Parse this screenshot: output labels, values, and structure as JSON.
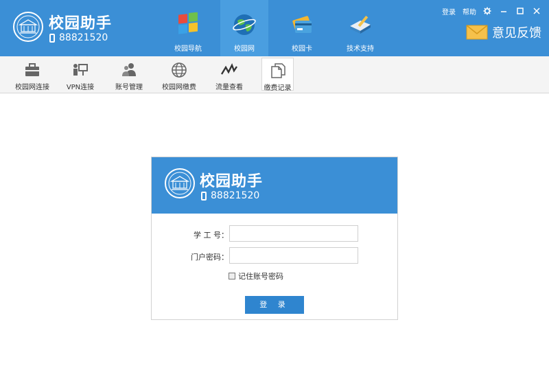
{
  "header": {
    "app_title": "校园助手",
    "phone": "88821520",
    "nav": [
      {
        "label": "校园导航",
        "icon": "windows-globe-icon"
      },
      {
        "label": "校园网",
        "icon": "globe-icon"
      },
      {
        "label": "校园卡",
        "icon": "card-icon"
      },
      {
        "label": "技术支持",
        "icon": "book-pencil-icon"
      }
    ],
    "active_nav": "校园网",
    "links": {
      "login": "登录",
      "help": "帮助"
    },
    "feedback": "意见反馈"
  },
  "toolbar": {
    "items": [
      {
        "label": "校园网连接",
        "icon": "briefcase-icon"
      },
      {
        "label": "VPN连接",
        "icon": "presenter-icon"
      },
      {
        "label": "账号管理",
        "icon": "users-icon"
      },
      {
        "label": "校园网缴费",
        "icon": "globe-grid-icon"
      },
      {
        "label": "流量查看",
        "icon": "line-chart-icon"
      },
      {
        "label": "缴费记录",
        "icon": "documents-icon"
      }
    ],
    "active_item": "缴费记录"
  },
  "login": {
    "title": "校园助手",
    "phone": "88821520",
    "id_label": "学 工 号：",
    "id_value": "",
    "password_label": "门户密码：",
    "password_value": "",
    "remember_label": "记住账号密码",
    "remember_checked": false,
    "submit_label": "登 录"
  },
  "colors": {
    "header_blue": "#3b8fd6",
    "button_blue": "#2f85cf"
  }
}
